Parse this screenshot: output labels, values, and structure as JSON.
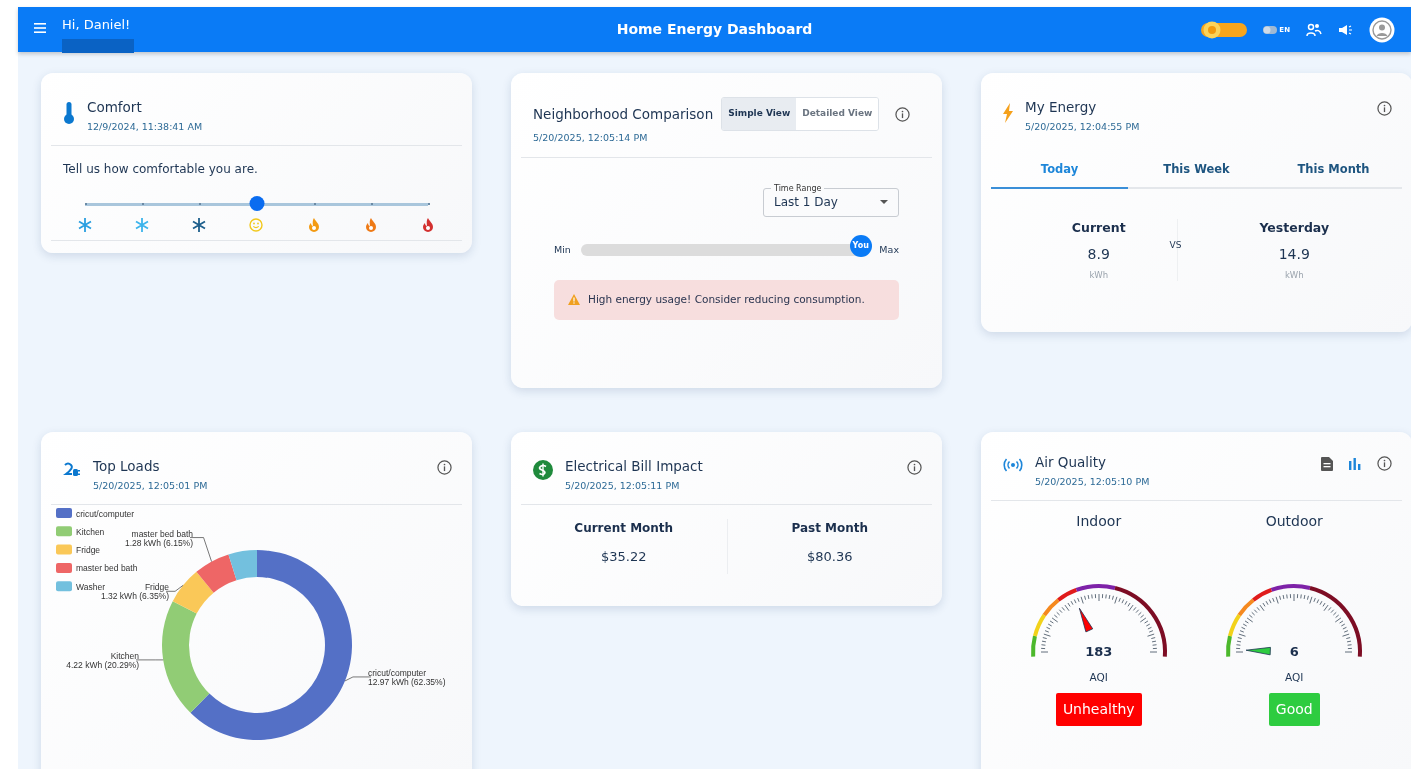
{
  "header": {
    "greeting": "Hi, Daniel!",
    "title": "Home Energy Dashboard",
    "theme_toggle": {
      "on": true
    },
    "language_toggle": {
      "label": "EN",
      "on": false
    }
  },
  "comfort": {
    "title": "Comfort",
    "timestamp": "12/9/2024, 11:38:41 AM",
    "prompt": "Tell us how comfortable you are.",
    "level": 0.5,
    "options": [
      {
        "kind": "cold",
        "color": "#2a9fe0"
      },
      {
        "kind": "cold",
        "color": "#3cb4ec"
      },
      {
        "kind": "cold",
        "color": "#1d5f8c"
      },
      {
        "kind": "neutral",
        "color": "#f2c81c"
      },
      {
        "kind": "hot",
        "color": "#f39a12"
      },
      {
        "kind": "hot",
        "color": "#ee7a16"
      },
      {
        "kind": "hot",
        "color": "#d3302f"
      }
    ]
  },
  "neighborhood": {
    "title": "Neighborhood Comparison",
    "timestamp": "5/20/2025, 12:05:14 PM",
    "views": [
      {
        "label": "Simple View",
        "selected": true
      },
      {
        "label": "Detailed View",
        "selected": false
      }
    ],
    "time_range": {
      "label": "Time Range",
      "value": "Last 1 Day"
    },
    "usage": {
      "min_label": "Min",
      "max_label": "Max",
      "marker": "You",
      "level": 0.97
    },
    "alert": "High energy usage! Consider reducing consumption."
  },
  "energy": {
    "title": "My Energy",
    "timestamp": "5/20/2025, 12:04:55 PM",
    "tabs": [
      {
        "label": "Today",
        "selected": true
      },
      {
        "label": "This Week",
        "selected": false
      },
      {
        "label": "This Month",
        "selected": false
      }
    ],
    "current": {
      "label": "Current",
      "value": "8.9",
      "unit": "kWh"
    },
    "separator": "VS",
    "previous": {
      "label": "Yesterday",
      "value": "14.9",
      "unit": "kWh"
    }
  },
  "top_loads": {
    "title": "Top Loads",
    "timestamp": "5/20/2025, 12:05:01 PM",
    "chart_data": {
      "type": "donut",
      "legend": "top-left",
      "categories": [
        "cricut/computer",
        "Kitchen",
        "Fridge",
        "master bed bath",
        "Washer"
      ],
      "colors": [
        "#5470c6",
        "#91cc75",
        "#fac858",
        "#ee6666",
        "#73c0de"
      ],
      "values": [
        62.35,
        20.29,
        6.35,
        6.15,
        4.86
      ]
    },
    "slice_labels": [
      {
        "name": "cricut/computer",
        "reading": "12.97 kWh (62.35%)"
      },
      {
        "name": "Kitchen",
        "reading": "4.22 kWh (20.29%)"
      },
      {
        "name": "Fridge",
        "reading": "1.32 kWh (6.35%)"
      },
      {
        "name": "master bed bath",
        "reading": "1.28 kWh (6.15%)"
      }
    ]
  },
  "bill": {
    "title": "Electrical Bill Impact",
    "timestamp": "5/20/2025, 12:05:11 PM",
    "columns": [
      {
        "label": "Current Month",
        "value": "$35.22"
      },
      {
        "label": "Past Month",
        "value": "$80.36"
      }
    ]
  },
  "air_quality": {
    "title": "Air Quality",
    "timestamp": "5/20/2025, 12:05:10 PM",
    "gauges": [
      {
        "label": "Indoor",
        "reading": "183",
        "unit": "AQI",
        "status": "Unhealthy",
        "color": "#ff0000"
      },
      {
        "label": "Outdoor",
        "reading": "6",
        "unit": "AQI",
        "status": "Good",
        "color": "#2ecc40"
      }
    ]
  }
}
